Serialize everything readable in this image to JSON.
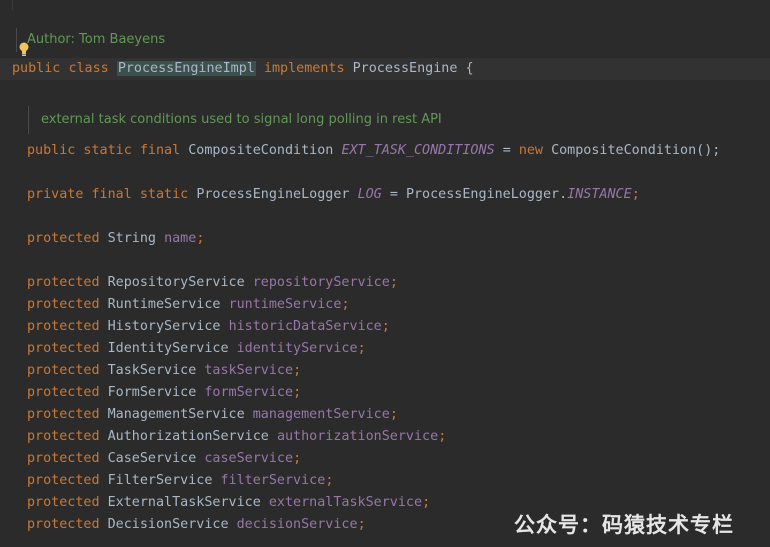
{
  "author_comment": "Author: Tom Baeyens",
  "class_decl": {
    "public_kw": "public",
    "class_kw": "class",
    "name": "ProcessEngineImpl",
    "implements_kw": "implements",
    "interface": "ProcessEngine",
    "brace": "{"
  },
  "ext_comment": "external task conditions used to signal long polling in rest API",
  "const_line": {
    "mods": "public static final",
    "type": "CompositeCondition",
    "name": "EXT_TASK_CONDITIONS",
    "eq": "=",
    "new_kw": "new",
    "init": "CompositeCondition();"
  },
  "log_line": {
    "mods": "private final static",
    "type": "ProcessEngineLogger",
    "name": "LOG",
    "eq": "=",
    "init_prefix": "ProcessEngineLogger.",
    "init_const": "INSTANCE",
    "semi": ";"
  },
  "name_line": {
    "mods": "protected",
    "type": "String",
    "name": "name",
    "semi": ";"
  },
  "services": [
    {
      "mods": "protected",
      "type": "RepositoryService",
      "name": "repositoryService",
      "semi": ";"
    },
    {
      "mods": "protected",
      "type": "RuntimeService",
      "name": "runtimeService",
      "semi": ";"
    },
    {
      "mods": "protected",
      "type": "HistoryService",
      "name": "historicDataService",
      "semi": ";"
    },
    {
      "mods": "protected",
      "type": "IdentityService",
      "name": "identityService",
      "semi": ";"
    },
    {
      "mods": "protected",
      "type": "TaskService",
      "name": "taskService",
      "semi": ";"
    },
    {
      "mods": "protected",
      "type": "FormService",
      "name": "formService",
      "semi": ";"
    },
    {
      "mods": "protected",
      "type": "ManagementService",
      "name": "managementService",
      "semi": ";"
    },
    {
      "mods": "protected",
      "type": "AuthorizationService",
      "name": "authorizationService",
      "semi": ";"
    },
    {
      "mods": "protected",
      "type": "CaseService",
      "name": "caseService",
      "semi": ";"
    },
    {
      "mods": "protected",
      "type": "FilterService",
      "name": "filterService",
      "semi": ";"
    },
    {
      "mods": "protected",
      "type": "ExternalTaskService",
      "name": "externalTaskService",
      "semi": ";"
    },
    {
      "mods": "protected",
      "type": "DecisionService",
      "name": "decisionService",
      "semi": ";"
    }
  ],
  "watermark": "公众号：码猿技术专栏",
  "icons": {
    "intention": "lightbulb-icon"
  },
  "colors": {
    "background": "#2b2b2b",
    "keyword": "#cc7832",
    "field": "#9876aa",
    "comment": "#629755",
    "text": "#a9b7c6"
  }
}
